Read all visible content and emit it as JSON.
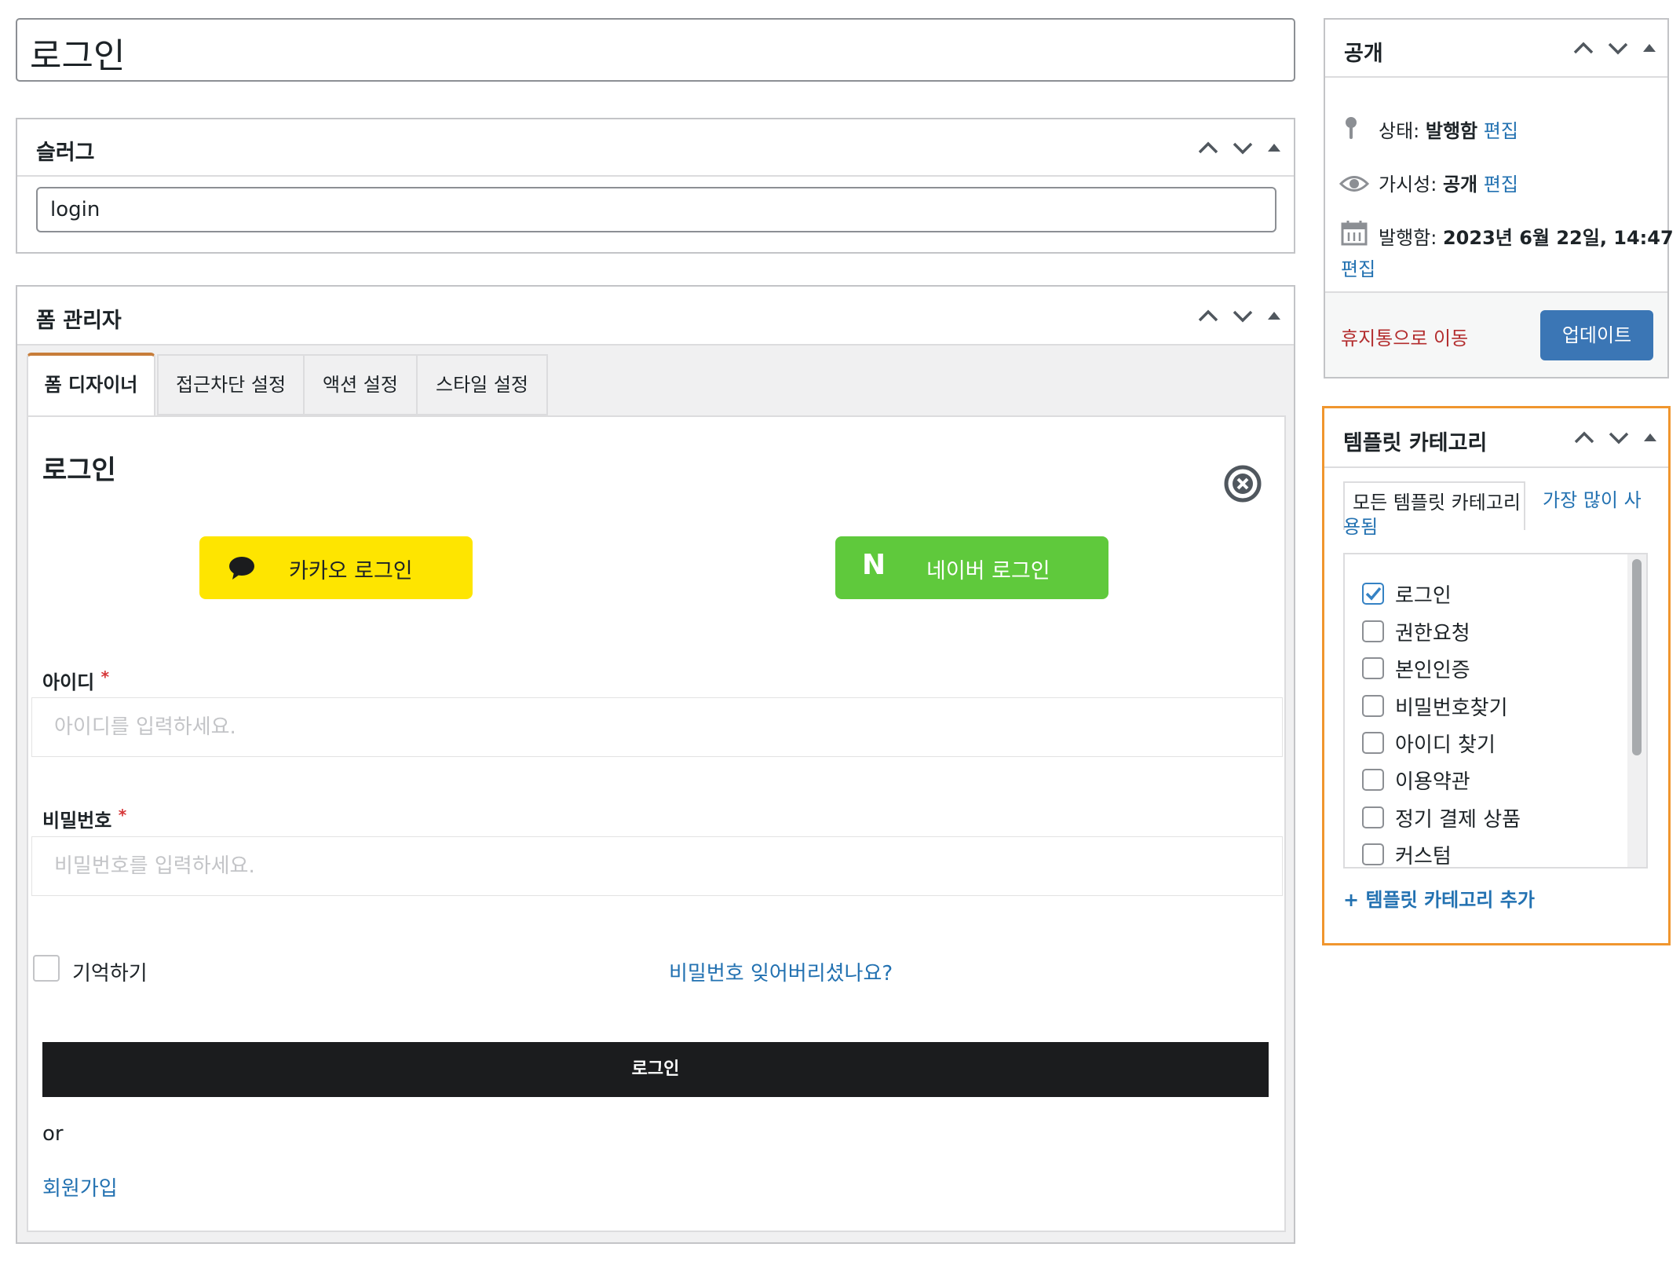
{
  "title_input": {
    "value": "로그인"
  },
  "slug_box": {
    "title": "슬러그",
    "slug_value": "login"
  },
  "form_manager": {
    "title": "폼 관리자",
    "tabs": [
      {
        "label": "폼 디자이너",
        "active": true
      },
      {
        "label": "접근차단 설정"
      },
      {
        "label": "액션 설정"
      },
      {
        "label": "스타일 설정"
      }
    ],
    "form": {
      "heading": "로그인",
      "kakao_label": "카카오 로그인",
      "naver_label": "네이버 로그인",
      "naver_logo": "N",
      "id_label": "아이디",
      "id_placeholder": "아이디를 입력하세요.",
      "password_label": "비밀번호",
      "password_placeholder": "비밀번호를 입력하세요.",
      "required_mark": "*",
      "remember_label": "기억하기",
      "forgot_link": "비밀번호 잊어버리셨나요?",
      "submit_label": "로그인",
      "or_text": "or",
      "signup_link": "회원가입"
    }
  },
  "publish_box": {
    "title": "공개",
    "status_label": "상태:",
    "status_value": "발행함",
    "visibility_label": "가시성:",
    "visibility_value": "공개",
    "published_label": "발행함:",
    "published_value": "2023년 6월 22일, 14:47",
    "edit_link": "편집",
    "trash_link": "휴지통으로 이동",
    "update_button": "업데이트"
  },
  "category_box": {
    "title": "템플릿 카테고리",
    "tab_all": "모든 템플릿 카테고리",
    "tab_popular_line1": "가장 많이 사",
    "tab_popular_line2": "용됨",
    "items": [
      {
        "label": "로그인",
        "checked": true
      },
      {
        "label": "권한요청",
        "checked": false
      },
      {
        "label": "본인인증",
        "checked": false
      },
      {
        "label": "비밀번호찾기",
        "checked": false
      },
      {
        "label": "아이디 찾기",
        "checked": false
      },
      {
        "label": "이용약관",
        "checked": false
      },
      {
        "label": "정기 결제 상품",
        "checked": false
      },
      {
        "label": "커스텀",
        "checked": false
      }
    ],
    "add_link": "+ 템플릿 카테고리 추가"
  },
  "colors": {
    "kakao_yellow": "#fee500",
    "naver_green": "#5fc93c",
    "link_blue": "#2271b1",
    "trash_red": "#b32d2e",
    "update_blue": "#3b76b5",
    "highlight_orange": "#f0962e",
    "tab_active_accent": "#c77d3a",
    "submit_black": "#1b1c1e"
  },
  "icons": [
    "chevron-up-icon",
    "chevron-down-icon",
    "toggle-arrow-icon",
    "pin-icon",
    "eye-icon",
    "calendar-icon",
    "close-circle-icon",
    "kakao-chat-icon",
    "naver-n-icon",
    "check-icon"
  ]
}
